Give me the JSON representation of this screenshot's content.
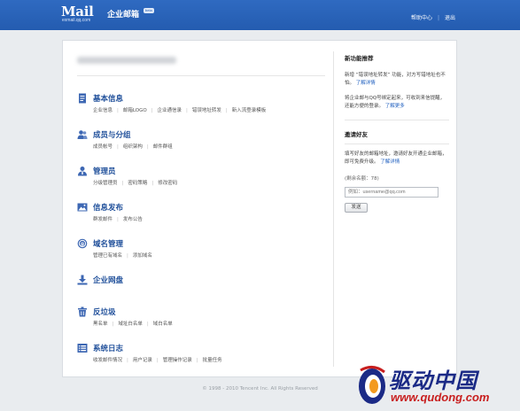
{
  "header": {
    "logo_text": "Mail",
    "logo_sub": "exmail.qq.com",
    "logo_cn": "企业邮箱",
    "logo_badge": "beta",
    "help": "帮助中心",
    "sep": "|",
    "logout": "退出"
  },
  "main": {
    "sections": [
      {
        "title": "基本信息",
        "icon": "document-icon",
        "links": [
          "企业信息",
          "邮箱LOGO",
          "企业通信录",
          "错误地址转发",
          "新入流登录模板"
        ]
      },
      {
        "title": "成员与分组",
        "icon": "users-icon",
        "links": [
          "成员帐号",
          "组织架构",
          "邮件群组"
        ]
      },
      {
        "title": "管理员",
        "icon": "admin-icon",
        "links": [
          "分级管理员",
          "密码策略",
          "修改密码"
        ]
      },
      {
        "title": "信息发布",
        "icon": "image-icon",
        "links": [
          "群发邮件",
          "发布公告"
        ]
      },
      {
        "title": "域名管理",
        "icon": "globe-icon",
        "links": [
          "管理已有域名",
          "添加域名"
        ]
      },
      {
        "title": "企业网盘",
        "icon": "download-icon",
        "links": []
      },
      {
        "title": "反垃圾",
        "icon": "trash-icon",
        "links": [
          "黑名单",
          "域址白名单",
          "域白名单"
        ]
      },
      {
        "title": "系统日志",
        "icon": "log-icon",
        "links": [
          "收发邮件情况",
          "用户记录",
          "管理操作记录",
          "批量任务"
        ]
      }
    ],
    "separator": "|"
  },
  "sidebar": {
    "new_heading": "新功能推荐",
    "p1": "新增 “错误地址转发” 功能，对方写错地址也不怕。",
    "p1_more": "了解详情",
    "p2": "将企业邮与QQ号绑定起来，可收到来信提醒，还能方便的登录。",
    "p2_more": "了解更多",
    "invite_heading": "邀请好友",
    "p3": "填写好友的邮箱地址，邀请好友开通企业邮箱，即可免费升级。",
    "p3_more": "了解详情",
    "quota": "(剩余名额：78)",
    "input_placeholder": "例如：username@qq.com",
    "send_label": "发送"
  },
  "footer": {
    "copyright": "© 1998 - 2010 Tencent Inc. All Rights Reserved"
  },
  "watermark": {
    "cn": "驱动中国",
    "url": "www.qudong.com"
  },
  "colors": {
    "header_blue": "#2f6ac1",
    "link_blue": "#1f4f9a",
    "watermark_red": "#c81e1e"
  }
}
